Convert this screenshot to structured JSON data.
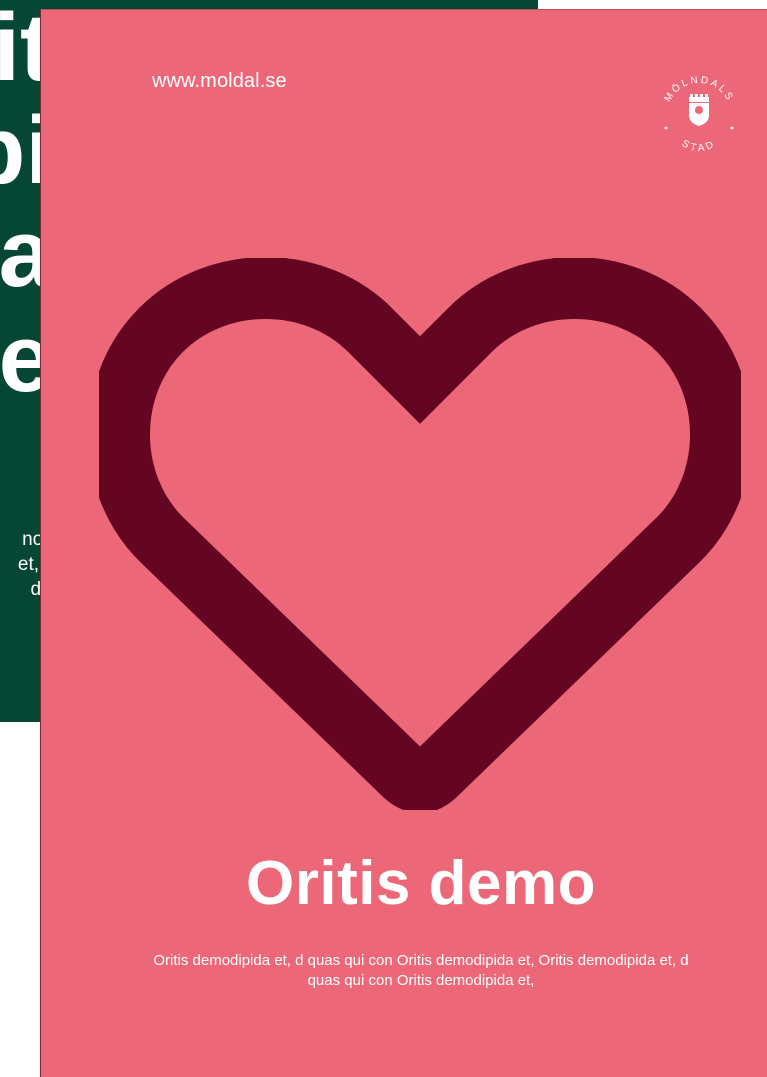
{
  "back_poster": {
    "headline_lines": [
      "it",
      "bi",
      "a",
      "e"
    ],
    "body_lines": [
      "nodi",
      "et, C",
      "der"
    ],
    "background_color": "#064634"
  },
  "front_poster": {
    "url": "www.moldal.se",
    "logo": {
      "icon": "molndals-stad-crest-icon",
      "top_text": "MÖLNDALS",
      "bottom_text": "STAD"
    },
    "heart_icon": "heart-icon",
    "title": "Oritis demo",
    "body": "Oritis demodipida et, d quas qui con Oritis demodipida et, Oritis demodipida et, d quas qui con Oritis demodipida et,",
    "background_color": "#EC6879",
    "heart_color": "#640622"
  }
}
